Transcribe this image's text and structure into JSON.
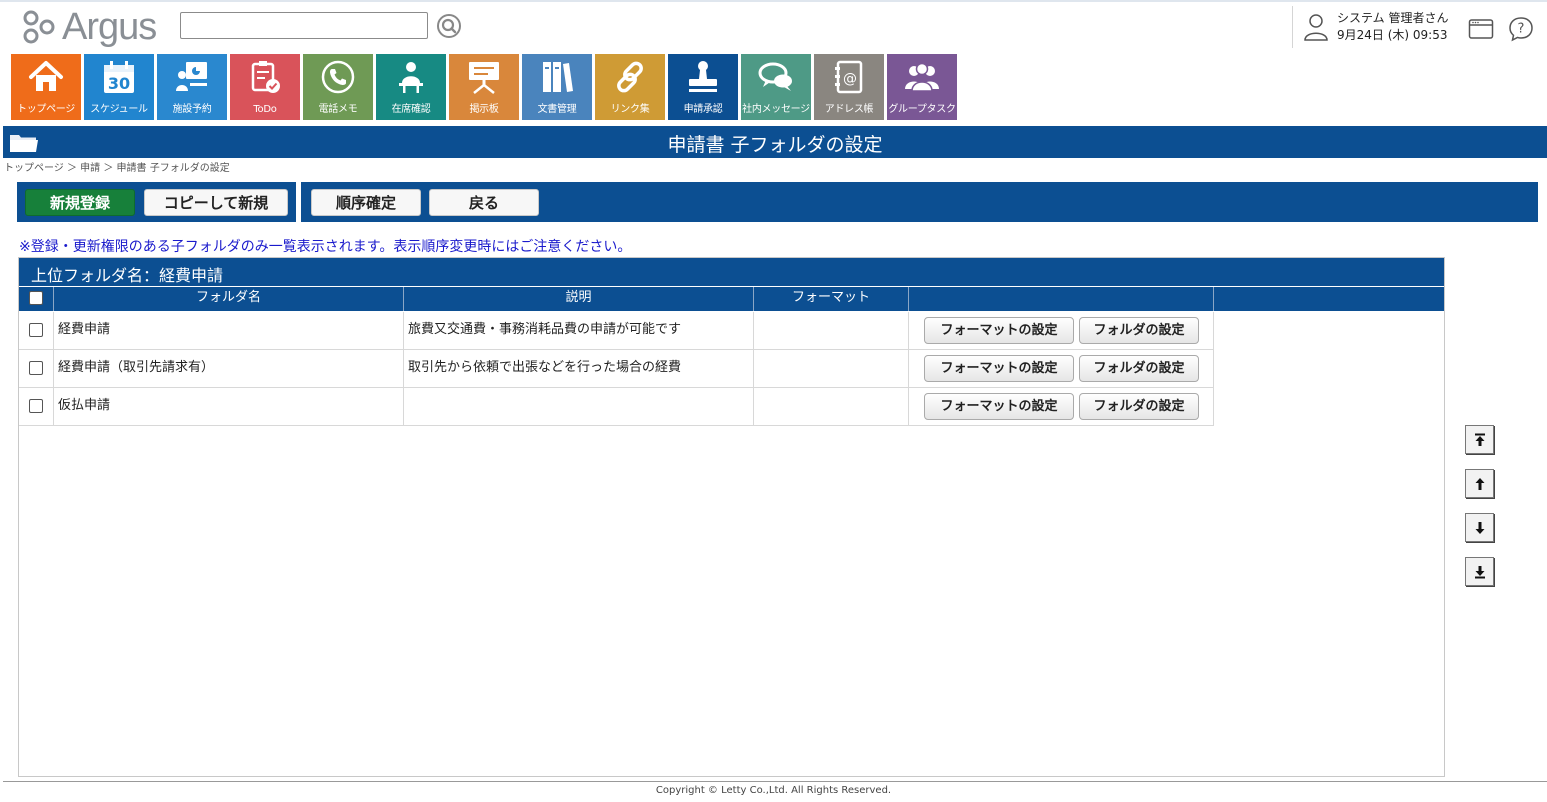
{
  "header": {
    "logo_text": "Argus",
    "search": {
      "value": "",
      "placeholder": ""
    },
    "user_name": "システム 管理者さん",
    "datetime": "9月24日 (木) 09:53"
  },
  "nav": [
    {
      "label": "トップページ",
      "color": "#ef6c1a",
      "icon": "home-icon"
    },
    {
      "label": "スケジュール",
      "color": "#2185cf",
      "icon": "calendar-icon",
      "calendar_day": "30"
    },
    {
      "label": "施設予約",
      "color": "#2a88cf",
      "icon": "facility-icon"
    },
    {
      "label": "ToDo",
      "color": "#d9535a",
      "icon": "todo-icon"
    },
    {
      "label": "電話メモ",
      "color": "#6f9a55",
      "icon": "phone-icon"
    },
    {
      "label": "在席確認",
      "color": "#178a83",
      "icon": "presence-icon"
    },
    {
      "label": "掲示板",
      "color": "#d9873b",
      "icon": "board-icon"
    },
    {
      "label": "文書管理",
      "color": "#4a84bd",
      "icon": "document-icon"
    },
    {
      "label": "リンク集",
      "color": "#cf9b35",
      "icon": "link-icon"
    },
    {
      "label": "申請承認",
      "color": "#0c4f92",
      "icon": "stamp-icon"
    },
    {
      "label": "社内メッセージ",
      "color": "#4e9a86",
      "icon": "message-icon"
    },
    {
      "label": "アドレス帳",
      "color": "#8a8680",
      "icon": "address-book-icon"
    },
    {
      "label": "グループタスク",
      "color": "#7a5795",
      "icon": "group-task-icon"
    }
  ],
  "page": {
    "title": "申請書 子フォルダの設定",
    "breadcrumb": "トップページ ＞ 申請 ＞ 申請書 子フォルダの設定"
  },
  "toolbar": {
    "new_label": "新規登録",
    "copy_new_label": "コピーして新規",
    "confirm_order_label": "順序確定",
    "back_label": "戻る"
  },
  "notice": "※登録・更新権限のある子フォルダのみ一覧表示されます。表示順序変更時にはご注意ください。",
  "list": {
    "parent_label": "上位フォルダ名：経費申請",
    "columns": [
      "フォルダ名",
      "説明",
      "フォーマット"
    ],
    "format_button_label": "フォーマットの設定",
    "folder_button_label": "フォルダの設定",
    "rows": [
      {
        "name": "経費申請",
        "description": "旅費又交通費・事務消耗品費の申請が可能です",
        "format": ""
      },
      {
        "name": "経費申請（取引先請求有）",
        "description": "取引先から依頼で出張などを行った場合の経費",
        "format": ""
      },
      {
        "name": "仮払申請",
        "description": "",
        "format": ""
      }
    ]
  },
  "footer": "Copyright © Letty Co.,Ltd. All Rights Reserved."
}
